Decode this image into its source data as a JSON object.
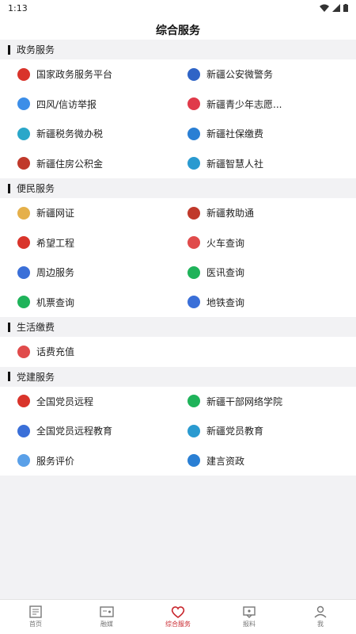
{
  "status": {
    "time": "1:13"
  },
  "header": {
    "title": "综合服务"
  },
  "colors": {
    "accent": "#c8252c"
  },
  "sections": [
    {
      "title": "政务服务",
      "items": [
        {
          "label": "国家政务服务平台",
          "icon": "national-emblem-icon",
          "color": "#d9342b"
        },
        {
          "label": "新疆公安微警务",
          "icon": "police-badge-icon",
          "color": "#2f64c6"
        },
        {
          "label": "四风/信访举报",
          "icon": "paper-plane-icon",
          "color": "#3c8ee8"
        },
        {
          "label": "新疆青少年志愿...",
          "icon": "heart-icon",
          "color": "#e03a4a"
        },
        {
          "label": "新疆税务微办税",
          "icon": "tax-icon",
          "color": "#2aa7c9"
        },
        {
          "label": "新疆社保缴费",
          "icon": "social-security-icon",
          "color": "#2a7fd4"
        },
        {
          "label": "新疆住房公积金",
          "icon": "housing-fund-icon",
          "color": "#c0392b"
        },
        {
          "label": "新疆智慧人社",
          "icon": "smart-hr-icon",
          "color": "#2a9ad0"
        }
      ]
    },
    {
      "title": "便民服务",
      "items": [
        {
          "label": "新疆网证",
          "icon": "net-id-icon",
          "color": "#e5b04a"
        },
        {
          "label": "新疆救助通",
          "icon": "rescue-icon",
          "color": "#c0392b"
        },
        {
          "label": "希望工程",
          "icon": "hope-project-icon",
          "color": "#d9342b"
        },
        {
          "label": "火车查询",
          "icon": "train-icon",
          "color": "#e04b4b"
        },
        {
          "label": "周边服务",
          "icon": "nearby-icon",
          "color": "#3a6fd8"
        },
        {
          "label": "医讯查询",
          "icon": "medical-icon",
          "color": "#1fb35a"
        },
        {
          "label": "机票查询",
          "icon": "airplane-icon",
          "color": "#1fb35a"
        },
        {
          "label": "地铁查询",
          "icon": "subway-icon",
          "color": "#3a6fd8"
        }
      ]
    },
    {
      "title": "生活缴费",
      "items": [
        {
          "label": "话费充值",
          "icon": "phone-recharge-icon",
          "color": "#e04b4b"
        }
      ]
    },
    {
      "title": "党建服务",
      "items": [
        {
          "label": "全国党员远程",
          "icon": "party-emblem-icon",
          "color": "#d9342b"
        },
        {
          "label": "新疆干部网络学院",
          "icon": "cadre-academy-icon",
          "color": "#1fb35a"
        },
        {
          "label": "全国党员远程教育",
          "icon": "education-icon",
          "color": "#3a6fd8"
        },
        {
          "label": "新疆党员教育",
          "icon": "party-education-icon",
          "color": "#2a9ad0"
        },
        {
          "label": "服务评价",
          "icon": "rating-icon",
          "color": "#5aa0e8"
        },
        {
          "label": "建言资政",
          "icon": "suggestion-icon",
          "color": "#2a7fd4"
        }
      ]
    }
  ],
  "bottom_nav": [
    {
      "label": "首页",
      "icon": "home-icon"
    },
    {
      "label": "融媒",
      "icon": "media-icon"
    },
    {
      "label": "综合服务",
      "icon": "service-heart-icon",
      "active": true
    },
    {
      "label": "报料",
      "icon": "report-icon"
    },
    {
      "label": "我",
      "icon": "profile-icon"
    }
  ]
}
